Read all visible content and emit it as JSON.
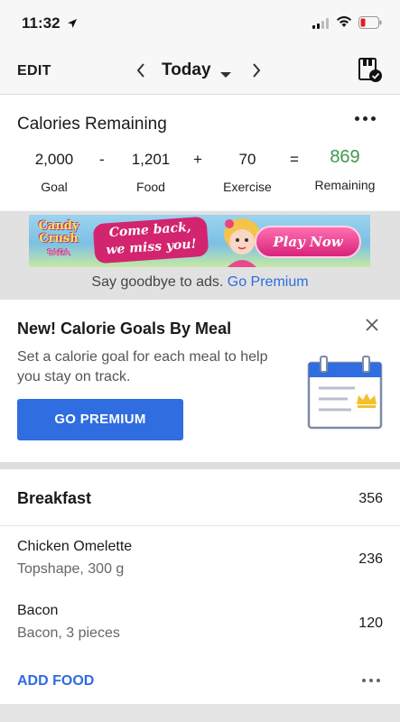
{
  "status_bar": {
    "time": "11:32"
  },
  "nav": {
    "edit": "EDIT",
    "title": "Today"
  },
  "calories": {
    "title": "Calories Remaining",
    "goal": {
      "value": "2,000",
      "label": "Goal"
    },
    "food": {
      "value": "1,201",
      "label": "Food"
    },
    "exercise": {
      "value": "70",
      "label": "Exercise"
    },
    "remaining": {
      "value": "869",
      "label": "Remaining"
    },
    "op_minus": "-",
    "op_plus": "+",
    "op_equals": "=",
    "accent_color": "#3f9a4f"
  },
  "ad": {
    "logo_line1": "Candy",
    "logo_line2": "Crush",
    "logo_line3": "SAGA",
    "banner_text_line1": "Come back,",
    "banner_text_line2": "we miss you!",
    "play_label": "Play Now",
    "note": "Say goodbye to ads.",
    "premium_link": "Go Premium"
  },
  "promo": {
    "title": "New! Calorie Goals By Meal",
    "description": "Set a calorie goal for each meal to help you stay on track.",
    "button_label": "GO PREMIUM",
    "button_color": "#2f6de0"
  },
  "meal": {
    "title": "Breakfast",
    "total": "356",
    "foods": [
      {
        "name": "Chicken Omelette",
        "desc": "Topshape, 300 g",
        "calories": "236"
      },
      {
        "name": "Bacon",
        "desc": "Bacon, 3 pieces",
        "calories": "120"
      }
    ],
    "add_food": "ADD FOOD"
  }
}
